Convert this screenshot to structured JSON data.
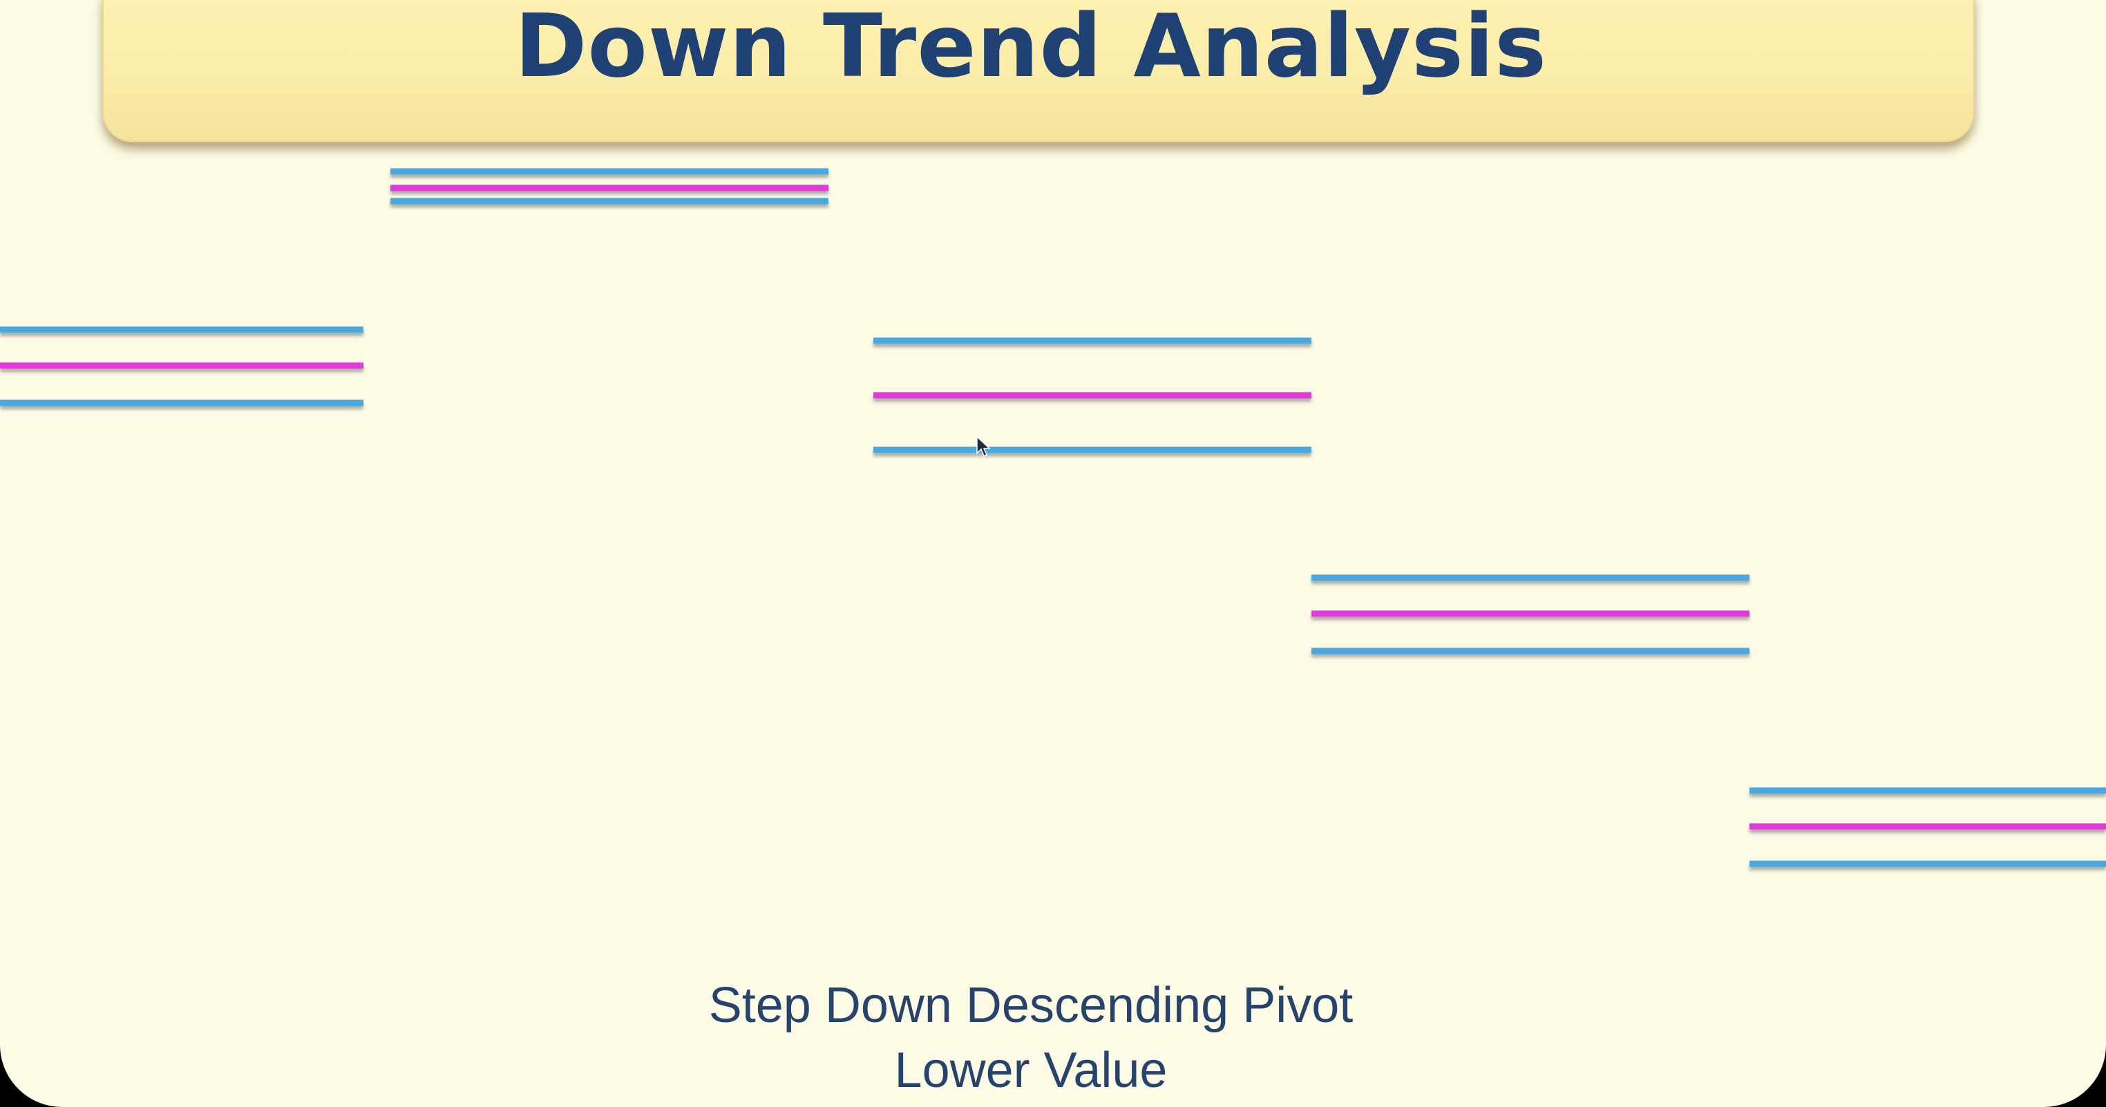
{
  "title": "Down Trend Analysis",
  "caption": {
    "line1": "Step Down Descending Pivot",
    "line2": "Lower Value"
  },
  "colors": {
    "background": "#fdfbe6",
    "banner": "#fbecaa",
    "title_text": "#1f4173",
    "pivot_range": "#4aa8e0",
    "pivot_center": "#e03ad8"
  },
  "icons": [
    "mouse-cursor-icon"
  ]
}
